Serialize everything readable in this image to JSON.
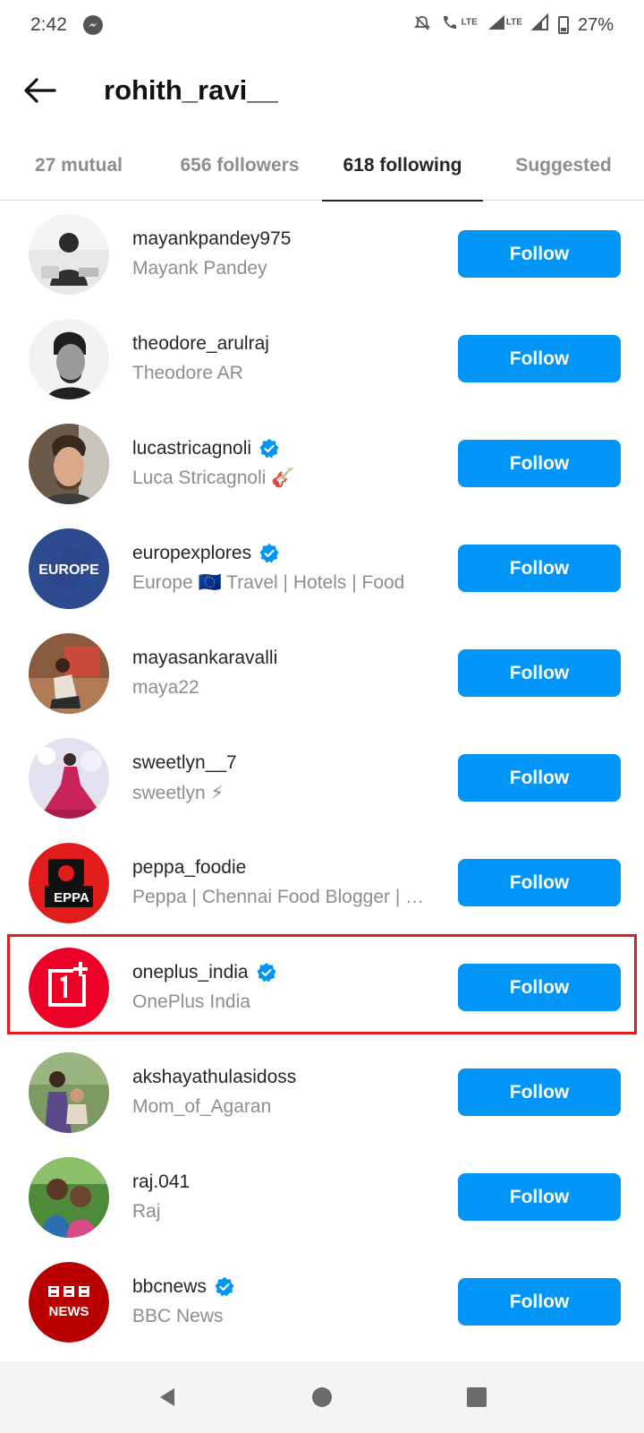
{
  "status_bar": {
    "time": "2:42",
    "messenger_icon": "messenger-icon",
    "lte_label_1": "LTE",
    "lte_label_2": "LTE",
    "battery": "27%"
  },
  "header": {
    "back_icon": "arrow-left-icon",
    "title": "rohith_ravi__"
  },
  "tabs": [
    {
      "label": "27 mutual",
      "active": false
    },
    {
      "label": "656 followers",
      "active": false
    },
    {
      "label": "618 following",
      "active": true
    },
    {
      "label": "Suggested",
      "active": false
    }
  ],
  "users": [
    {
      "username": "mayankpandey975",
      "fullname": "Mayank Pandey",
      "verified": false,
      "button": "Follow"
    },
    {
      "username": "theodore_arulraj",
      "fullname": "Theodore AR",
      "verified": false,
      "button": "Follow"
    },
    {
      "username": "lucastricagnoli",
      "fullname": "Luca Stricagnoli 🎸",
      "verified": true,
      "button": "Follow"
    },
    {
      "username": "europexplores",
      "fullname": "Europe 🇪🇺 Travel | Hotels | Food",
      "verified": true,
      "button": "Follow",
      "avatar_text": "EUROPE"
    },
    {
      "username": "mayasankaravalli",
      "fullname": "maya22",
      "verified": false,
      "button": "Follow"
    },
    {
      "username": "sweetlyn__7",
      "fullname": "sweetlyn ⚡",
      "verified": false,
      "button": "Follow"
    },
    {
      "username": "peppa_foodie",
      "fullname": "Peppa | Chennai Food Blogger | Food",
      "verified": false,
      "button": "Follow",
      "avatar_text": "EPPA"
    },
    {
      "username": "oneplus_india",
      "fullname": "OnePlus India",
      "verified": true,
      "button": "Follow",
      "highlighted": true
    },
    {
      "username": "akshayathulasidoss",
      "fullname": "Mom_of_Agaran",
      "verified": false,
      "button": "Follow"
    },
    {
      "username": "raj.041",
      "fullname": "Raj",
      "verified": false,
      "button": "Follow"
    },
    {
      "username": "bbcnews",
      "fullname": "BBC News",
      "verified": true,
      "button": "Follow",
      "avatar_text": "NEWS"
    }
  ],
  "colors": {
    "follow_button": "#0095f6",
    "verified": "#0095f6",
    "highlight_border": "#e02020"
  },
  "navbar": {
    "back": "nav-back-icon",
    "home": "nav-home-icon",
    "recents": "nav-recents-icon"
  }
}
